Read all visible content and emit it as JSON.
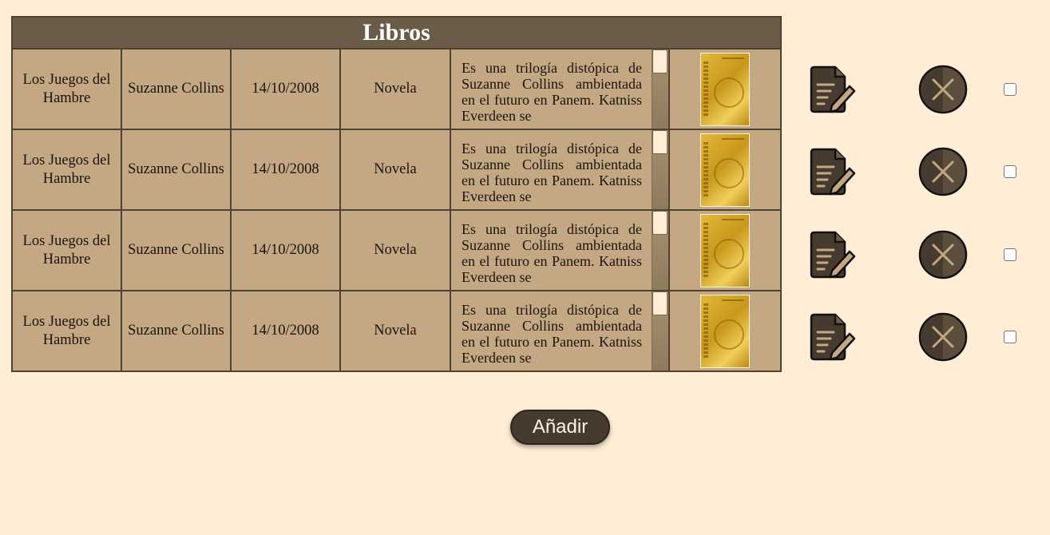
{
  "table": {
    "title": "Libros",
    "rows": [
      {
        "title": "Los Juegos del Hambre",
        "author": "Suzanne Collins",
        "date": "14/10/2008",
        "genre": "Novela",
        "description": "Es una trilogía distópica de Suzanne Collins ambientada en el futuro en Panem. Katniss Everdeen se",
        "cover_icon": "book-cover-image"
      },
      {
        "title": "Los Juegos del Hambre",
        "author": "Suzanne Collins",
        "date": "14/10/2008",
        "genre": "Novela",
        "description": "Es una trilogía distópica de Suzanne Collins ambientada en el futuro en Panem. Katniss Everdeen se",
        "cover_icon": "book-cover-image"
      },
      {
        "title": "Los Juegos del Hambre",
        "author": "Suzanne Collins",
        "date": "14/10/2008",
        "genre": "Novela",
        "description": "Es una trilogía distópica de Suzanne Collins ambientada en el futuro en Panem. Katniss Everdeen se",
        "cover_icon": "book-cover-image"
      },
      {
        "title": "Los Juegos del Hambre",
        "author": "Suzanne Collins",
        "date": "14/10/2008",
        "genre": "Novela",
        "description": "Es una trilogía distópica de Suzanne Collins ambientada en el futuro en Panem. Katniss Everdeen se",
        "cover_icon": "book-cover-image"
      }
    ]
  },
  "actions": {
    "edit_icon": "edit-document-icon",
    "delete_icon": "delete-x-icon",
    "select_checked": [
      false,
      false,
      false,
      false
    ]
  },
  "add_button": {
    "label": "Añadir"
  },
  "colors": {
    "background": "#ffedd6",
    "header": "#6b5c4a",
    "cell": "#c4a883",
    "border": "#4e4233",
    "button": "#463b2e"
  }
}
